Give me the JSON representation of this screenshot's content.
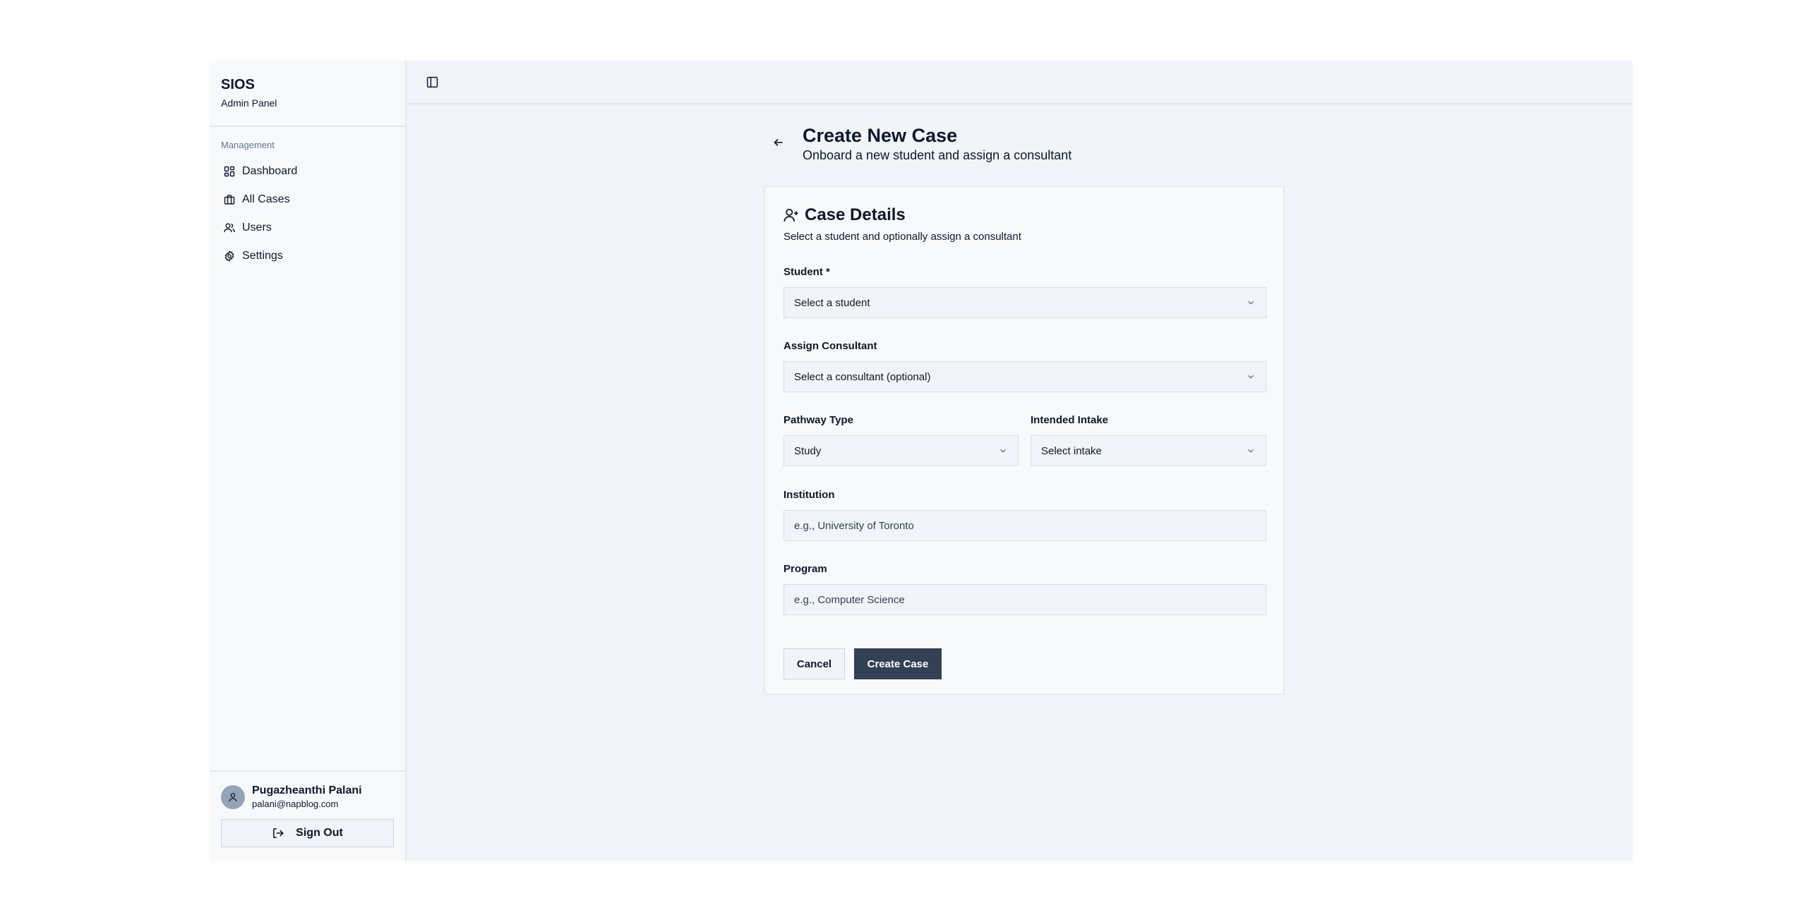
{
  "sidebar": {
    "brand_title": "SIOS",
    "brand_subtitle": "Admin Panel",
    "section_label": "Management",
    "items": [
      {
        "label": "Dashboard",
        "icon": "dashboard-icon"
      },
      {
        "label": "All Cases",
        "icon": "briefcase-icon"
      },
      {
        "label": "Users",
        "icon": "users-icon"
      },
      {
        "label": "Settings",
        "icon": "gear-icon"
      }
    ],
    "user": {
      "name": "Pugazheanthi Palani",
      "email": "palani@napblog.com"
    },
    "signout_label": "Sign Out"
  },
  "header": {
    "title": "Create New Case",
    "subtitle": "Onboard a new student and assign a consultant"
  },
  "card": {
    "title": "Case Details",
    "subtitle": "Select a student and optionally assign a consultant",
    "student": {
      "label": "Student *",
      "value": "Select a student"
    },
    "consultant": {
      "label": "Assign Consultant",
      "value": "Select a consultant (optional)"
    },
    "pathway": {
      "label": "Pathway Type",
      "value": "Study"
    },
    "intake": {
      "label": "Intended Intake",
      "value": "Select intake"
    },
    "institution": {
      "label": "Institution",
      "placeholder": "e.g., University of Toronto"
    },
    "program": {
      "label": "Program",
      "placeholder": "e.g., Computer Science"
    },
    "cancel_label": "Cancel",
    "create_label": "Create Case"
  },
  "colors": {
    "primary_button": "#334155",
    "background": "#f1f4f8",
    "sidebar": "#f8f9fa"
  }
}
